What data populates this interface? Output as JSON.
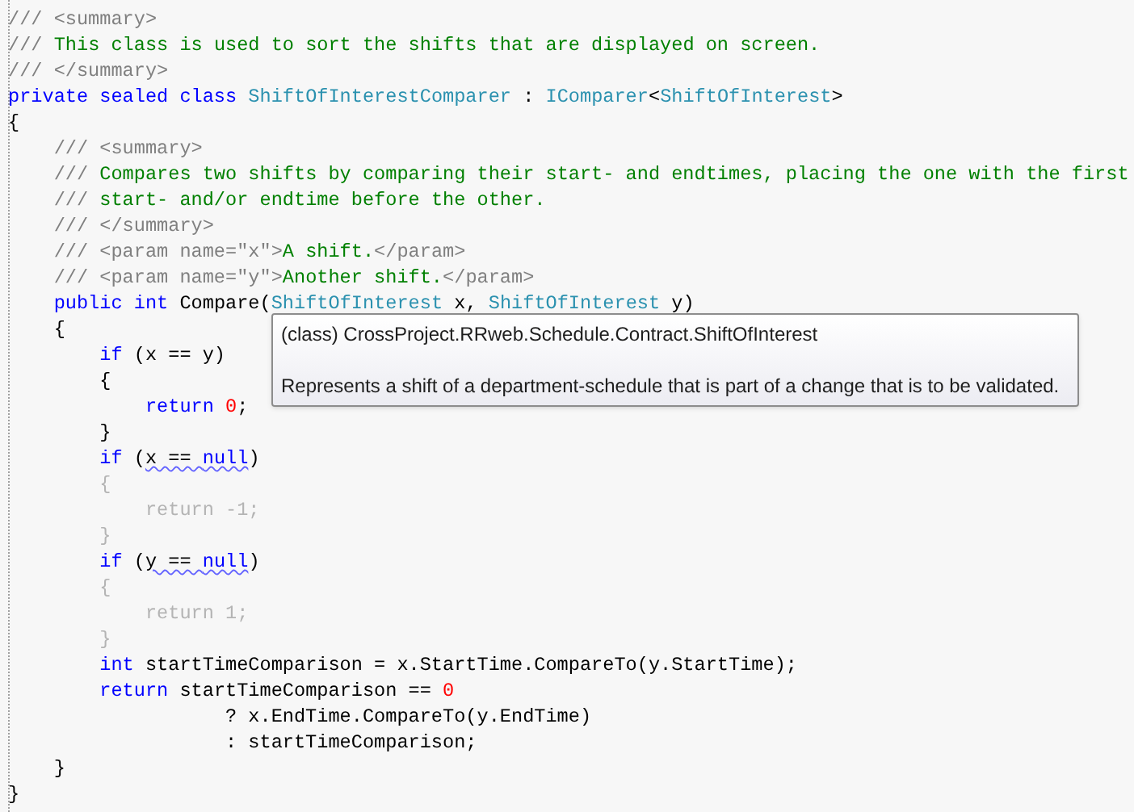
{
  "editor": {
    "lines": [
      {
        "segments": [
          {
            "kind": "doc",
            "text": "/// <summary>"
          }
        ]
      },
      {
        "segments": [
          {
            "kind": "doc",
            "text": "///"
          },
          {
            "kind": "comment",
            "text": " This class is used to sort the shifts that are displayed on screen."
          }
        ]
      },
      {
        "segments": [
          {
            "kind": "doc",
            "text": "/// </summary>"
          }
        ]
      },
      {
        "segments": [
          {
            "kind": "keyword",
            "text": "private sealed class "
          },
          {
            "kind": "type",
            "text": "ShiftOfInterestComparer"
          },
          {
            "kind": "plain",
            "text": " : "
          },
          {
            "kind": "type",
            "text": "IComparer"
          },
          {
            "kind": "plain",
            "text": "<"
          },
          {
            "kind": "type",
            "text": "ShiftOfInterest"
          },
          {
            "kind": "plain",
            "text": ">"
          }
        ]
      },
      {
        "segments": [
          {
            "kind": "plain",
            "text": "{"
          }
        ]
      },
      {
        "segments": [
          {
            "kind": "doc",
            "text": "    /// <summary>"
          }
        ]
      },
      {
        "segments": [
          {
            "kind": "doc",
            "text": "    ///"
          },
          {
            "kind": "comment",
            "text": " Compares two shifts by comparing their start- and endtimes, placing the one with the first"
          }
        ]
      },
      {
        "segments": [
          {
            "kind": "doc",
            "text": "    ///"
          },
          {
            "kind": "comment",
            "text": " start- and/or endtime before the other."
          }
        ]
      },
      {
        "segments": [
          {
            "kind": "doc",
            "text": "    /// </summary>"
          }
        ]
      },
      {
        "segments": [
          {
            "kind": "doc",
            "text": "    /// <param name=\"x\">"
          },
          {
            "kind": "comment",
            "text": "A shift."
          },
          {
            "kind": "doc",
            "text": "</param>"
          }
        ]
      },
      {
        "segments": [
          {
            "kind": "doc",
            "text": "    /// <param name=\"y\">"
          },
          {
            "kind": "comment",
            "text": "Another shift."
          },
          {
            "kind": "doc",
            "text": "</param>"
          }
        ]
      },
      {
        "segments": [
          {
            "kind": "keyword",
            "text": "    public int"
          },
          {
            "kind": "plain",
            "text": " Compare("
          },
          {
            "kind": "type",
            "text": "ShiftOfInterest"
          },
          {
            "kind": "plain",
            "text": " x, "
          },
          {
            "kind": "type",
            "text": "ShiftOfInterest"
          },
          {
            "kind": "plain",
            "text": " y)"
          }
        ]
      },
      {
        "segments": [
          {
            "kind": "plain",
            "text": "    {"
          }
        ]
      },
      {
        "segments": [
          {
            "kind": "keyword",
            "text": "        if"
          },
          {
            "kind": "plain",
            "text": " (x == y)"
          }
        ]
      },
      {
        "segments": [
          {
            "kind": "plain",
            "text": "        {"
          }
        ]
      },
      {
        "segments": [
          {
            "kind": "keyword",
            "text": "            return "
          },
          {
            "kind": "number",
            "text": "0"
          },
          {
            "kind": "plain",
            "text": ";"
          }
        ]
      },
      {
        "segments": [
          {
            "kind": "plain",
            "text": "        }"
          }
        ]
      },
      {
        "segments": [
          {
            "kind": "keyword",
            "text": "        if"
          },
          {
            "kind": "plain",
            "text": " ("
          },
          {
            "kind": "warning",
            "text": "x == "
          },
          {
            "kind": "warning_keyword",
            "text": "null"
          },
          {
            "kind": "plain",
            "text": ")"
          }
        ]
      },
      {
        "segments": [
          {
            "kind": "unreachable",
            "text": "        {"
          }
        ]
      },
      {
        "segments": [
          {
            "kind": "unreachable",
            "text": "            return -1;"
          }
        ]
      },
      {
        "segments": [
          {
            "kind": "unreachable",
            "text": "        }"
          }
        ]
      },
      {
        "segments": [
          {
            "kind": "keyword",
            "text": "        if"
          },
          {
            "kind": "plain",
            "text": " ("
          },
          {
            "kind": "warning",
            "text": "y == "
          },
          {
            "kind": "warning_keyword",
            "text": "null"
          },
          {
            "kind": "plain",
            "text": ")"
          }
        ]
      },
      {
        "segments": [
          {
            "kind": "unreachable",
            "text": "        {"
          }
        ]
      },
      {
        "segments": [
          {
            "kind": "unreachable",
            "text": "            return 1;"
          }
        ]
      },
      {
        "segments": [
          {
            "kind": "unreachable",
            "text": "        }"
          }
        ]
      },
      {
        "segments": [
          {
            "kind": "keyword",
            "text": "        int"
          },
          {
            "kind": "plain",
            "text": " startTimeComparison = x.StartTime.CompareTo(y.StartTime);"
          }
        ]
      },
      {
        "segments": [
          {
            "kind": "keyword",
            "text": "        return"
          },
          {
            "kind": "plain",
            "text": " startTimeComparison == "
          },
          {
            "kind": "number",
            "text": "0"
          }
        ]
      },
      {
        "segments": [
          {
            "kind": "plain",
            "text": "                   ? x.EndTime.CompareTo(y.EndTime)"
          }
        ]
      },
      {
        "segments": [
          {
            "kind": "plain",
            "text": "                   : startTimeComparison;"
          }
        ]
      },
      {
        "segments": [
          {
            "kind": "plain",
            "text": "    }"
          }
        ]
      },
      {
        "segments": [
          {
            "kind": "plain",
            "text": "}"
          }
        ]
      }
    ]
  },
  "tooltip": {
    "signature": "(class) CrossProject.RRweb.Schedule.Contract.ShiftOfInterest",
    "description": "Represents a shift of a department-schedule that is part of a change that is to be validated."
  }
}
